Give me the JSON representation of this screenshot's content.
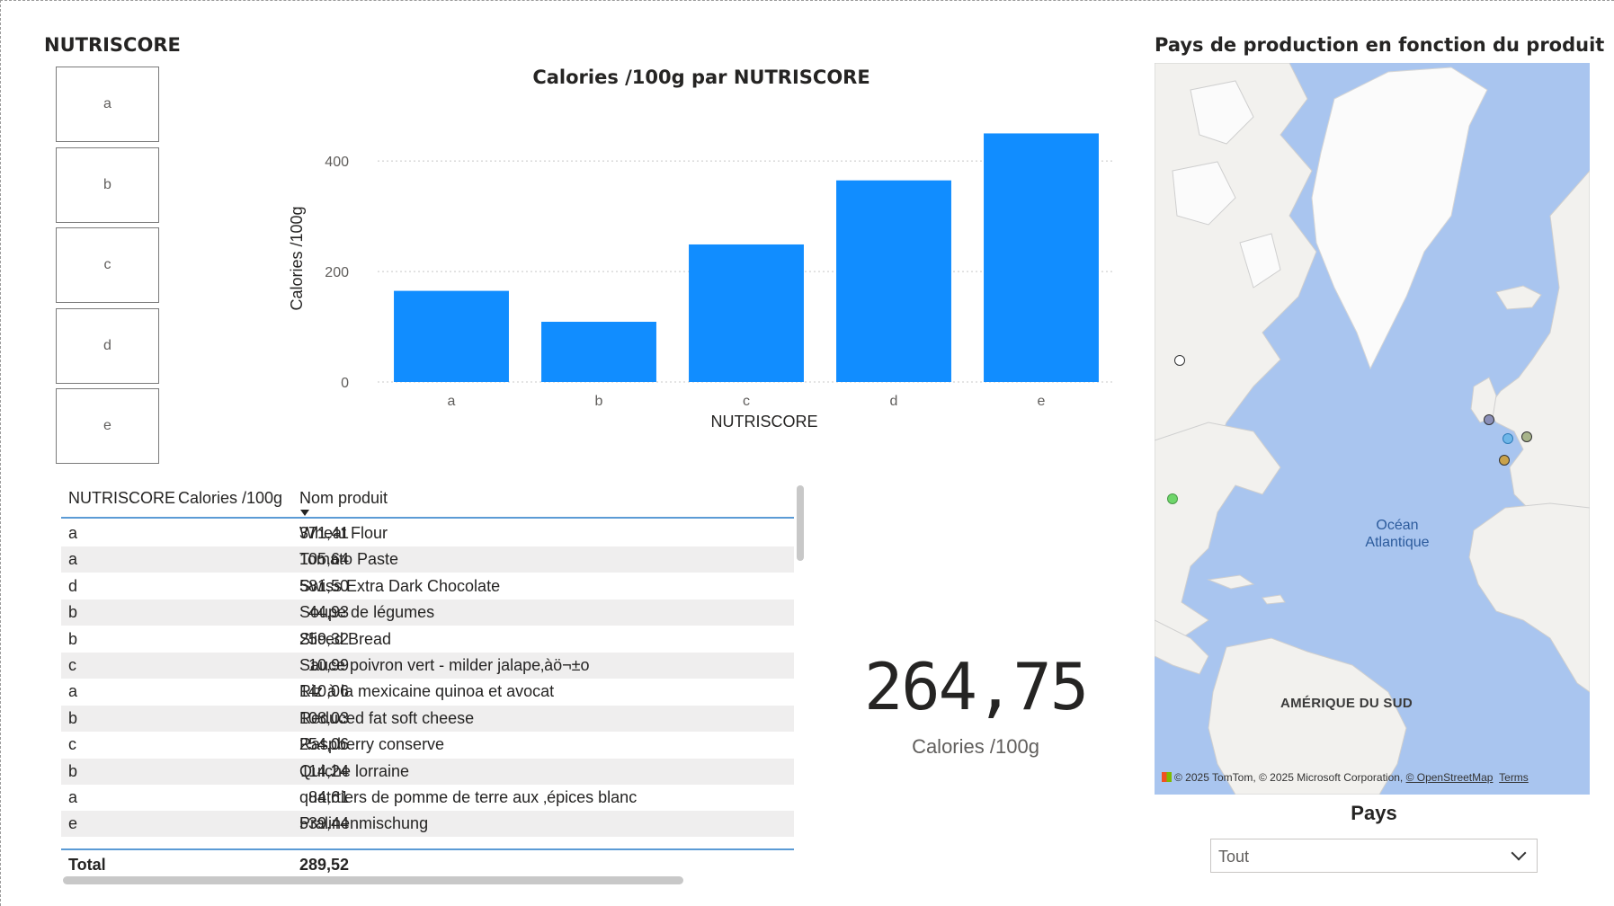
{
  "slicer": {
    "title": "NUTRISCORE",
    "options": [
      "a",
      "b",
      "c",
      "d",
      "e"
    ]
  },
  "chart": {
    "title": "Calories /100g par NUTRISCORE"
  },
  "chart_data": {
    "type": "bar",
    "title": "Calories /100g par NUTRISCORE",
    "xlabel": "NUTRISCORE",
    "ylabel": "Calories /100g",
    "categories": [
      "a",
      "b",
      "c",
      "d",
      "e"
    ],
    "values": [
      165,
      109,
      249,
      365,
      450
    ],
    "yticks": [
      0,
      200,
      400
    ],
    "ylim": [
      0,
      480
    ],
    "grid": true,
    "bar_color": "#118dff"
  },
  "table": {
    "headers": [
      "NUTRISCORE",
      "Calories /100g",
      "Nom produit"
    ],
    "rows": [
      {
        "score": "a",
        "cal": "371,41",
        "name": "Wheat Flour"
      },
      {
        "score": "a",
        "cal": "105,64",
        "name": "Tomato Paste"
      },
      {
        "score": "d",
        "cal": "581,50",
        "name": "Swiss Extra Dark Chocolate"
      },
      {
        "score": "b",
        "cal": "44,93",
        "name": "Soupe de légumes"
      },
      {
        "score": "b",
        "cal": "259,32",
        "name": "Sliced Bread"
      },
      {
        "score": "c",
        "cal": "10,99",
        "name": "Sauce poivron vert - milder jalape‚àö¬±o"
      },
      {
        "score": "a",
        "cal": "140,06",
        "name": "Riz à la mexicaine quinoa et avocat"
      },
      {
        "score": "b",
        "cal": "108,03",
        "name": "Reduced fat soft cheese"
      },
      {
        "score": "c",
        "cal": "254,06",
        "name": "Raspberry conserve"
      },
      {
        "score": "b",
        "cal": "114,24",
        "name": "Quiche lorraine"
      },
      {
        "score": "a",
        "cal": "84,61",
        "name": "quatrtiers de pomme de terre aux ‚épices blanc"
      },
      {
        "score": "e",
        "cal": "539,44",
        "name": "Pralinenmischung"
      }
    ],
    "total_label": "Total",
    "total_value": "289,52"
  },
  "kpi": {
    "value": "264,75",
    "label": "Calories /100g"
  },
  "map": {
    "title": "Pays de production en fonction du produit",
    "ocean_label_line1": "Océan",
    "ocean_label_line2": "Atlantique",
    "continent_label": "AMÉRIQUE DU SUD",
    "copyright": "© 2025 TomTom, © 2025 Microsoft Corporation, ",
    "osm_link": "© OpenStreetMap",
    "terms_link": "Terms",
    "colors": {
      "water": "#a9c5ef",
      "land": "#f2f1ee",
      "ice": "#fbfbfb"
    }
  },
  "pays": {
    "title": "Pays",
    "selected": "Tout"
  }
}
